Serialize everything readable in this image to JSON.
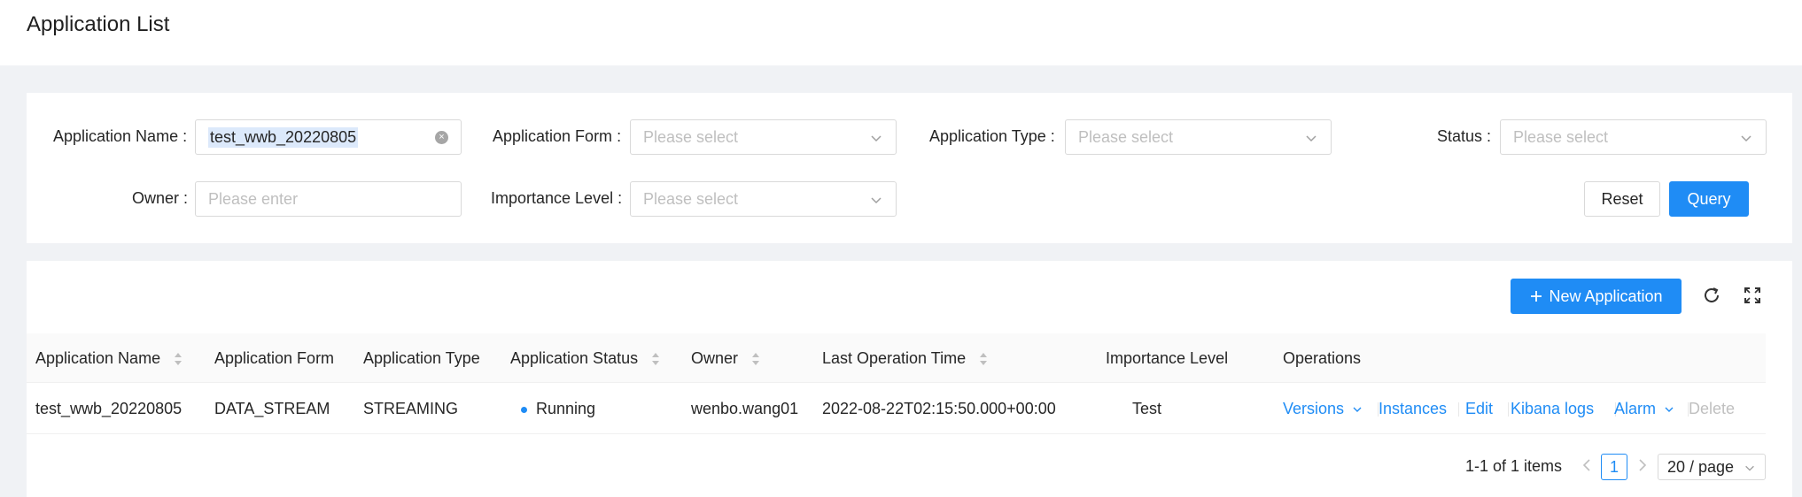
{
  "header": {
    "title": "Application List"
  },
  "filters": {
    "app_name": {
      "label": "Application Name",
      "value": "test_wwb_20220805"
    },
    "app_form": {
      "label": "Application Form",
      "placeholder": "Please select"
    },
    "app_type": {
      "label": "Application Type",
      "placeholder": "Please select"
    },
    "status": {
      "label": "Status",
      "placeholder": "Please select"
    },
    "owner": {
      "label": "Owner",
      "placeholder": "Please enter"
    },
    "importance": {
      "label": "Importance Level",
      "placeholder": "Please select"
    },
    "reset_label": "Reset",
    "query_label": "Query"
  },
  "toolbar": {
    "new_app_label": "New Application",
    "icons": [
      "reload-icon",
      "fullscreen-icon"
    ]
  },
  "table": {
    "columns": [
      "Application Name",
      "Application Form",
      "Application Type",
      "Application Status",
      "Owner",
      "Last Operation Time",
      "Importance Level",
      "Operations"
    ],
    "rows": [
      {
        "name": "test_wwb_20220805",
        "form": "DATA_STREAM",
        "type": "STREAMING",
        "status": "Running",
        "owner": "wenbo.wang01",
        "last_op_time": "2022-08-22T02:15:50.000+00:00",
        "importance": "Test",
        "operations": {
          "versions": "Versions",
          "instances": "Instances",
          "edit": "Edit",
          "kibana": "Kibana logs",
          "alarm": "Alarm",
          "delete": "Delete"
        }
      }
    ]
  },
  "pagination": {
    "summary": "1-1 of 1 items",
    "current_page": "1",
    "page_size": "20 / page"
  },
  "colors": {
    "primary": "#1f8cf5",
    "background": "#f0f2f5",
    "status_running": "#1f8cf5"
  }
}
